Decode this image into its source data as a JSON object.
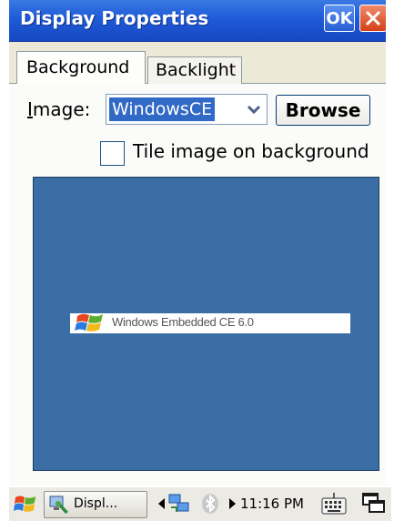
{
  "window": {
    "title": "Display Properties",
    "ok_label": "OK",
    "close_icon": "close-icon",
    "title_bar_color": "#1f5ad8"
  },
  "tabs": [
    {
      "label": "Background",
      "active": true
    },
    {
      "label": "Backlight",
      "active": false
    }
  ],
  "background_tab": {
    "image_label": "Image:",
    "image_label_mnemonic": "I",
    "image_value": "WindowsCE",
    "browse_label": "Browse",
    "tile_label": "Tile image on background",
    "tile_checked": false,
    "preview_color": "#3b6ea5",
    "preview_logo_text": "Windows Embedded CE 6.0"
  },
  "taskbar": {
    "start_icon": "windows-flag-icon",
    "task_label": "Displ...",
    "task_icon": "display-properties-icon",
    "clock": "11:16 PM",
    "tray_icons": [
      "network-icon",
      "bluetooth-icon",
      "keyboard-icon",
      "desktop-icon"
    ]
  }
}
